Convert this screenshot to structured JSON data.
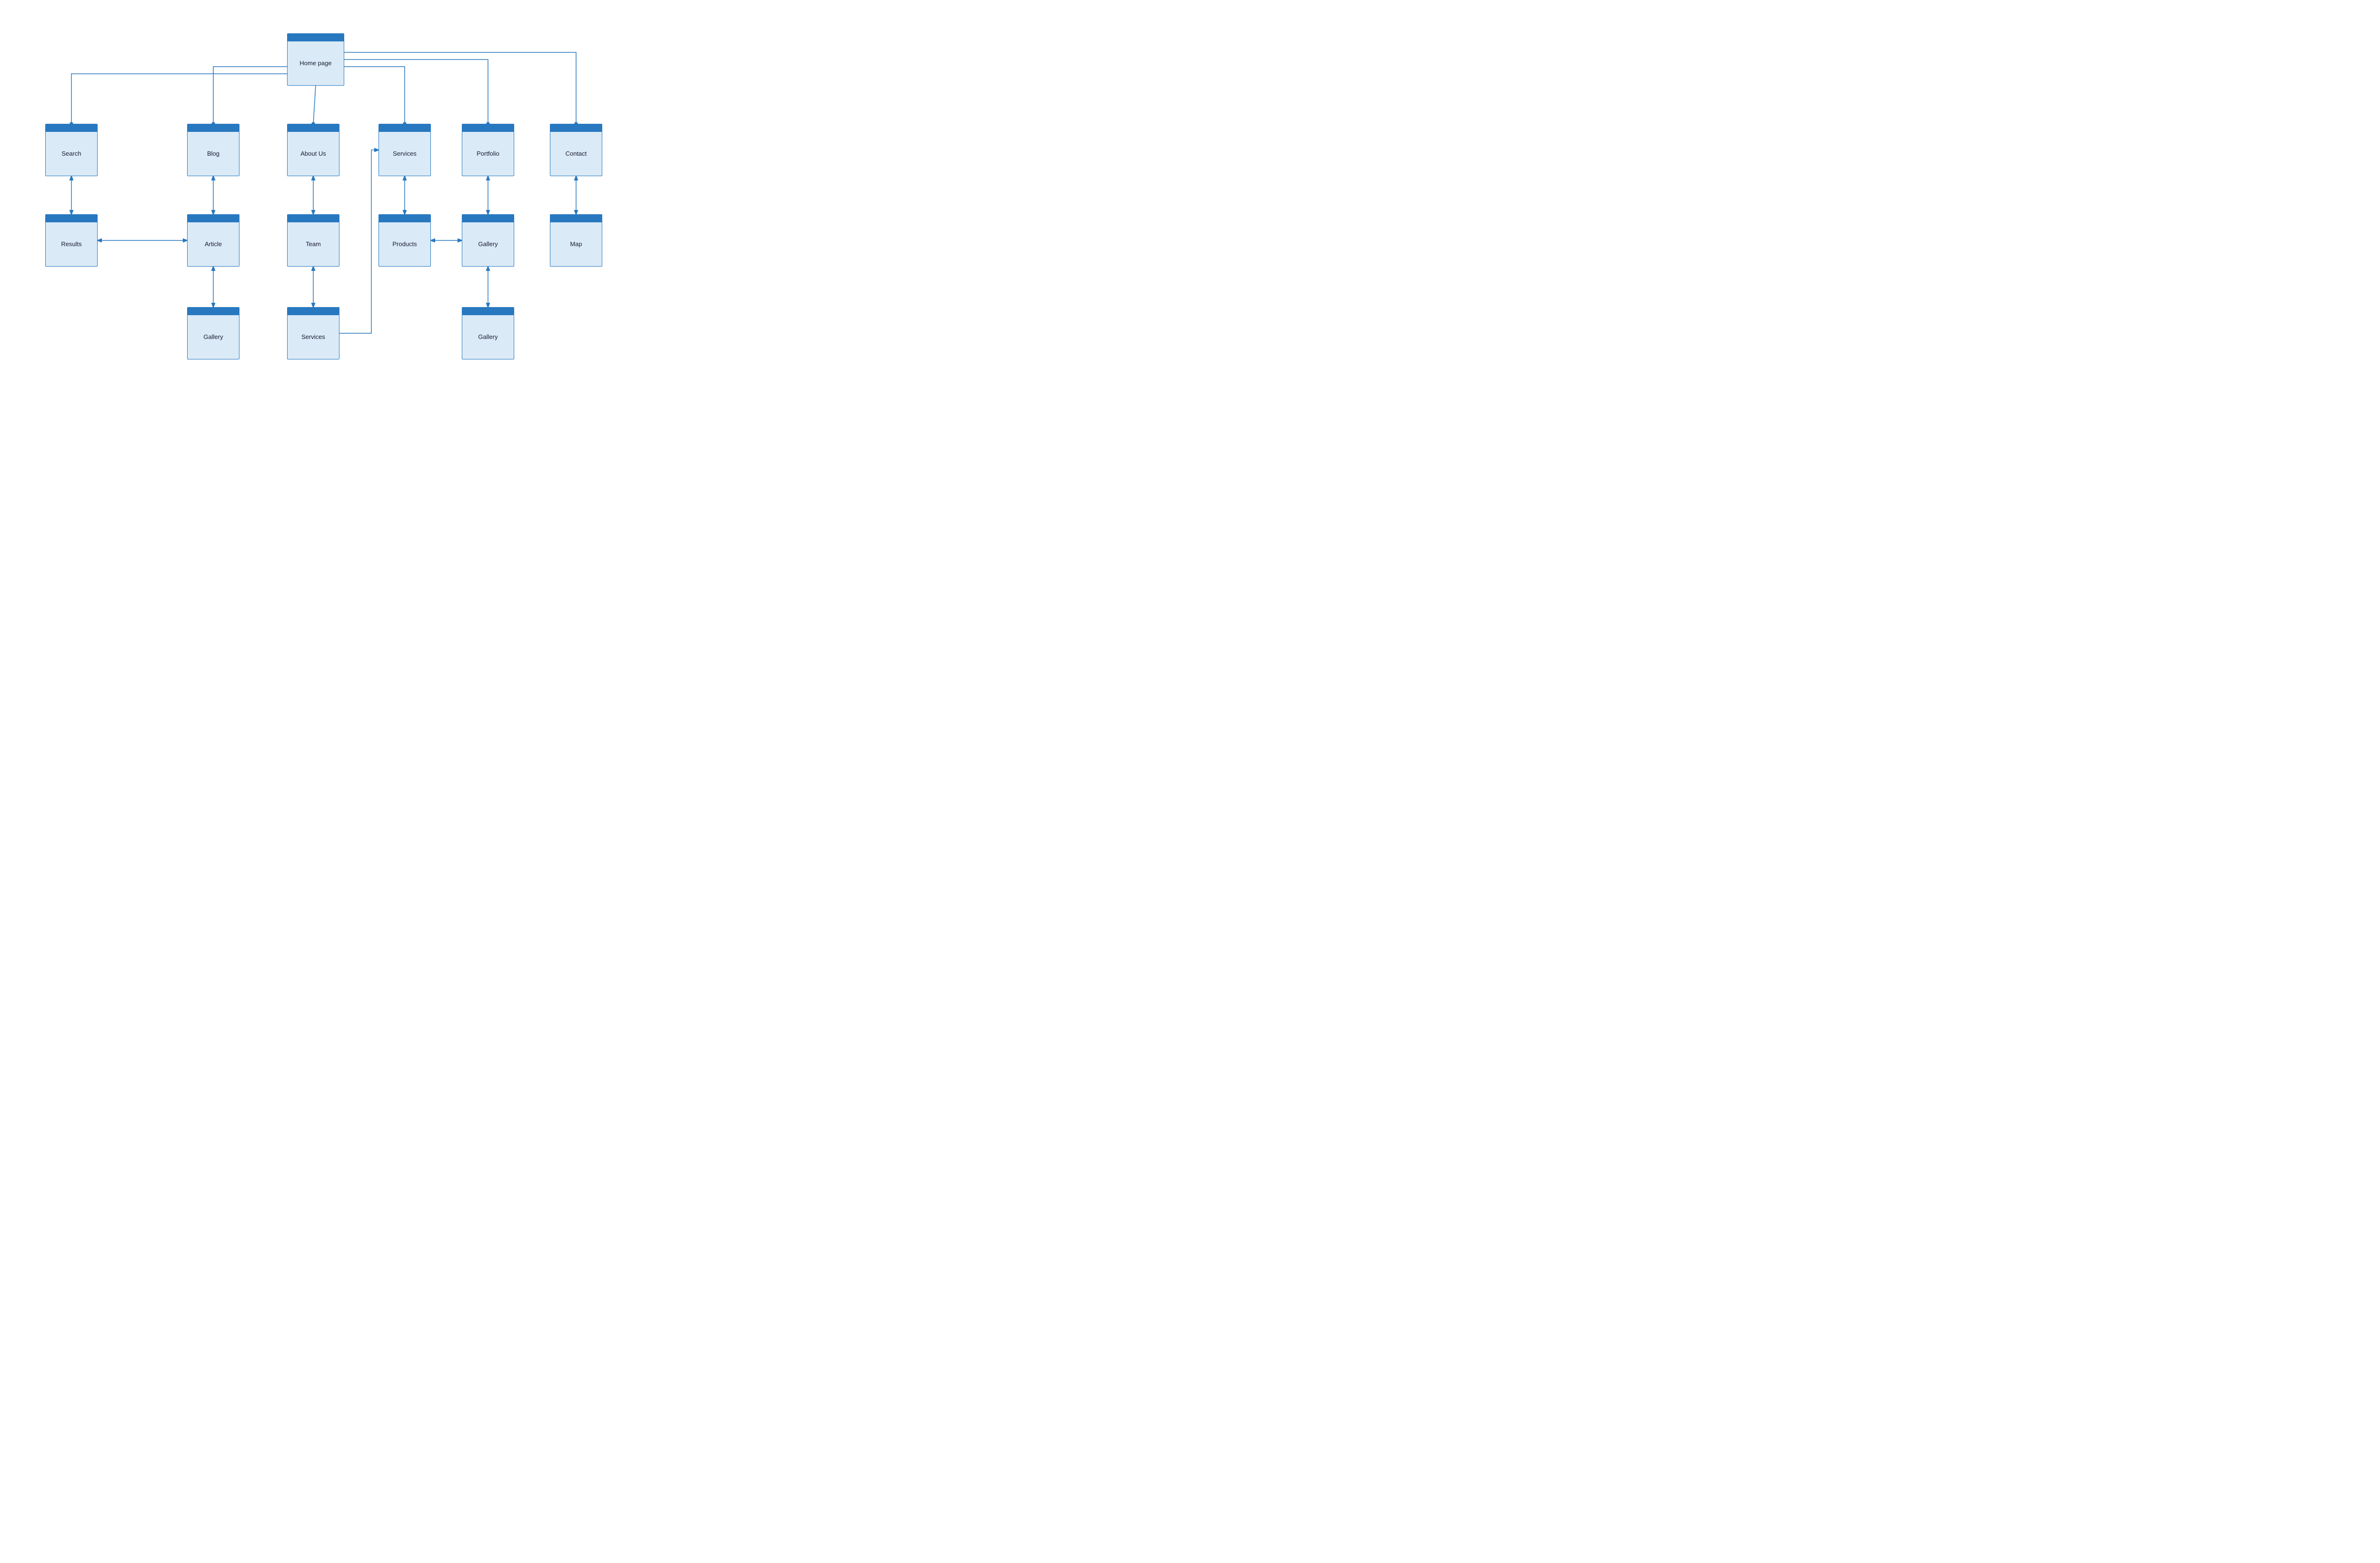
{
  "nodes": {
    "home": {
      "label": "Home\npage"
    },
    "search": {
      "label": "Search"
    },
    "blog": {
      "label": "Blog"
    },
    "aboutus": {
      "label": "About Us"
    },
    "services_l2": {
      "label": "Services"
    },
    "portfolio": {
      "label": "Portfolio"
    },
    "contact": {
      "label": "Contact"
    },
    "results": {
      "label": "Results"
    },
    "article": {
      "label": "Article"
    },
    "team": {
      "label": "Team"
    },
    "products": {
      "label": "Products"
    },
    "gallery_p": {
      "label": "Gallery"
    },
    "map": {
      "label": "Map"
    },
    "gallery_blog": {
      "label": "Gallery"
    },
    "services_aboutus": {
      "label": "Services"
    },
    "gallery_port": {
      "label": "Gallery"
    }
  },
  "colors": {
    "header": "#2878c0",
    "body": "#daeaf7",
    "line": "#2878c0"
  }
}
